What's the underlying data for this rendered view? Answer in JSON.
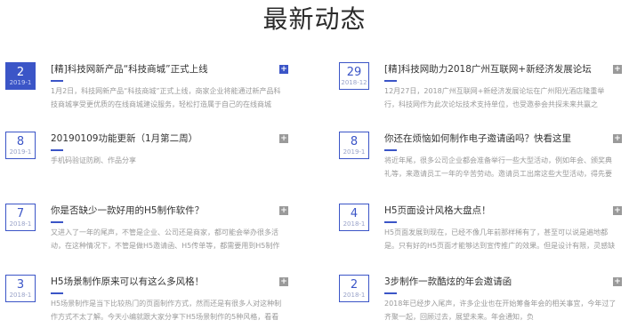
{
  "page": {
    "title": "最新动态"
  },
  "news": [
    {
      "day": "2",
      "ym": "2019-1",
      "title": "[精]科技网新产品“科技商城”正式上线",
      "desc": "1月2日，科技网新产品“科技商城”正式上线，商家企业将能通过新产品科技商城享受更优质的在线商城建设服务，轻松打造属于自己的在线商城",
      "plus": "+"
    },
    {
      "day": "29",
      "ym": "2018-12",
      "title": "[精]科技网助力2018广州互联网+新经济发展论坛",
      "desc": "12月27日，2018广州互联网+新经济发展论坛在广州阳光酒店隆重举行，科技网作为此次论坛技术支持单位，也受邀参会共探未来共赢之路......",
      "plus": "+"
    },
    {
      "day": "8",
      "ym": "2019-1",
      "title": "20190109功能更新（1月第二周）",
      "desc": "手机码验证防刷、作品分享",
      "plus": "+"
    },
    {
      "day": "8",
      "ym": "2019-1",
      "title": "你还在烦恼如何制作电子邀请函吗？快看这里",
      "desc": "将近年尾，很多公司企业都会准备举行一些大型活动，例如年会、颁奖典礼等，来邀请员工一年的辛苦劳动。邀请员工出席这些大型活动，得先要准备",
      "plus": "+"
    },
    {
      "day": "7",
      "ym": "2018-1",
      "title": "你是否缺少一款好用的H5制作软件？",
      "desc": "又进入了一年的尾声，不管是企业、公司还是商家，都可能会举办很多活动，在这种情况下，不管是做H5邀请函、H5传单等，都需要用到H5制作软",
      "plus": "+"
    },
    {
      "day": "4",
      "ym": "2018-1",
      "title": "H5页面设计风格大盘点！",
      "desc": "H5页面发展到现在，已经不像几年前那样稀有了，甚至可以说是遍地都是。只有好的H5页面才能够达到宣传推广的效果。但是设计有限，灵感缺",
      "plus": "+"
    },
    {
      "day": "3",
      "ym": "2018-1",
      "title": "H5场景制作原来可以有这么多风格！",
      "desc": "H5场景制作是当下比较热门的页面制作方式，然而还是有很多人对这种制作方式不太了解。今天小编就跟大家分享下H5场景制作的5种风格，看看你",
      "plus": "+"
    },
    {
      "day": "2",
      "ym": "2018-1",
      "title": "3步制作一款酷炫的年会邀请函",
      "desc": "2018年已经步入尾声，许多企业也在开始筹备年会的相关事宜，今年过了齐聚一起，回顾过去，展望未来。年会通知，负",
      "plus": "+"
    }
  ]
}
